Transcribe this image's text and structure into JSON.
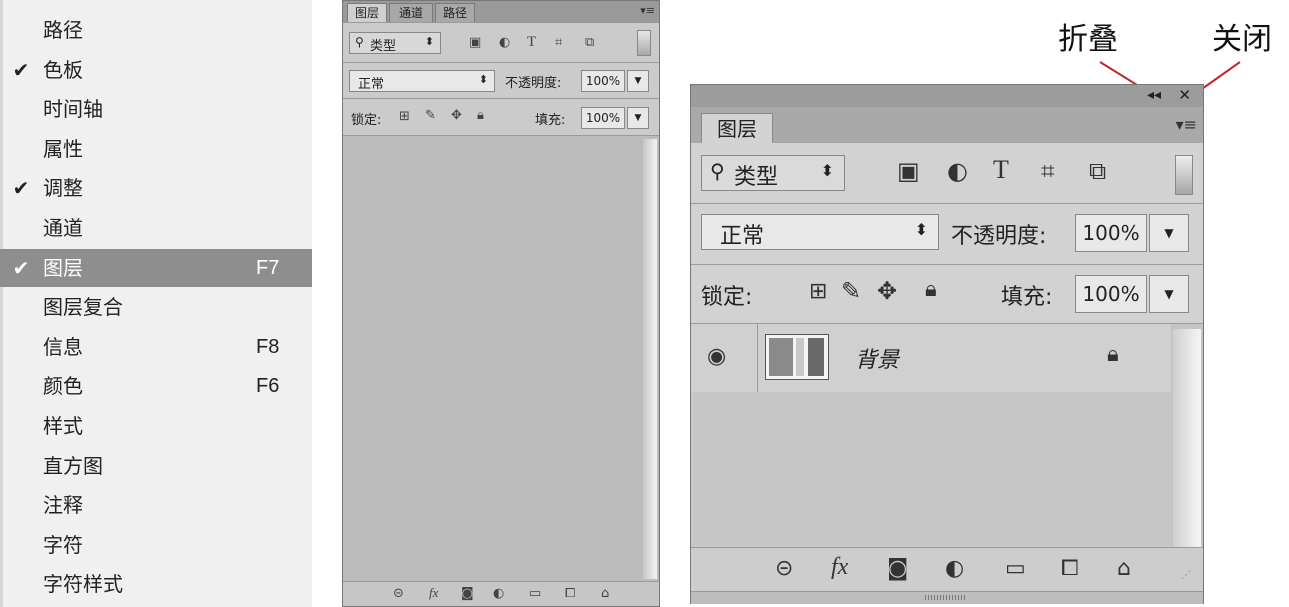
{
  "menu": {
    "items": [
      {
        "label": "路径",
        "checked": false,
        "shortcut": ""
      },
      {
        "label": "色板",
        "checked": true,
        "shortcut": ""
      },
      {
        "label": "时间轴",
        "checked": false,
        "shortcut": ""
      },
      {
        "label": "属性",
        "checked": false,
        "shortcut": ""
      },
      {
        "label": "调整",
        "checked": true,
        "shortcut": ""
      },
      {
        "label": "通道",
        "checked": false,
        "shortcut": ""
      },
      {
        "label": "图层",
        "checked": true,
        "shortcut": "F7",
        "active": true
      },
      {
        "label": "图层复合",
        "checked": false,
        "shortcut": ""
      },
      {
        "label": "信息",
        "checked": false,
        "shortcut": "F8"
      },
      {
        "label": "颜色",
        "checked": false,
        "shortcut": "F6"
      },
      {
        "label": "样式",
        "checked": false,
        "shortcut": ""
      },
      {
        "label": "直方图",
        "checked": false,
        "shortcut": ""
      },
      {
        "label": "注释",
        "checked": false,
        "shortcut": ""
      },
      {
        "label": "字符",
        "checked": false,
        "shortcut": ""
      },
      {
        "label": "字符样式",
        "checked": false,
        "shortcut": ""
      }
    ],
    "check_glyph": "✔"
  },
  "small_panel": {
    "tabs": [
      "图层",
      "通道",
      "路径"
    ],
    "active_tab": "图层",
    "filter_label": "类型",
    "blend_mode": "正常",
    "opacity_label": "不透明度:",
    "opacity_value": "100%",
    "lock_label": "锁定:",
    "fill_label": "填充:",
    "fill_value": "100%"
  },
  "annotations": {
    "collapse": "折叠",
    "close": "关闭"
  },
  "large_panel": {
    "tab": "图层",
    "filter_label": "类型",
    "blend_mode": "正常",
    "opacity_label": "不透明度:",
    "opacity_value": "100%",
    "lock_label": "锁定:",
    "fill_label": "填充:",
    "fill_value": "100%",
    "layer_name": "背景",
    "collapse_glyph": "◂◂",
    "close_glyph": "✕"
  },
  "icon_names": [
    "search-icon",
    "image-filter-icon",
    "adjustment-filter-icon",
    "type-filter-icon",
    "shape-filter-icon",
    "smart-object-filter-icon",
    "link-icon",
    "fx-icon",
    "mask-icon",
    "adjustment-layer-icon",
    "folder-icon",
    "new-layer-icon",
    "trash-icon",
    "eye-icon",
    "lock-icon"
  ]
}
